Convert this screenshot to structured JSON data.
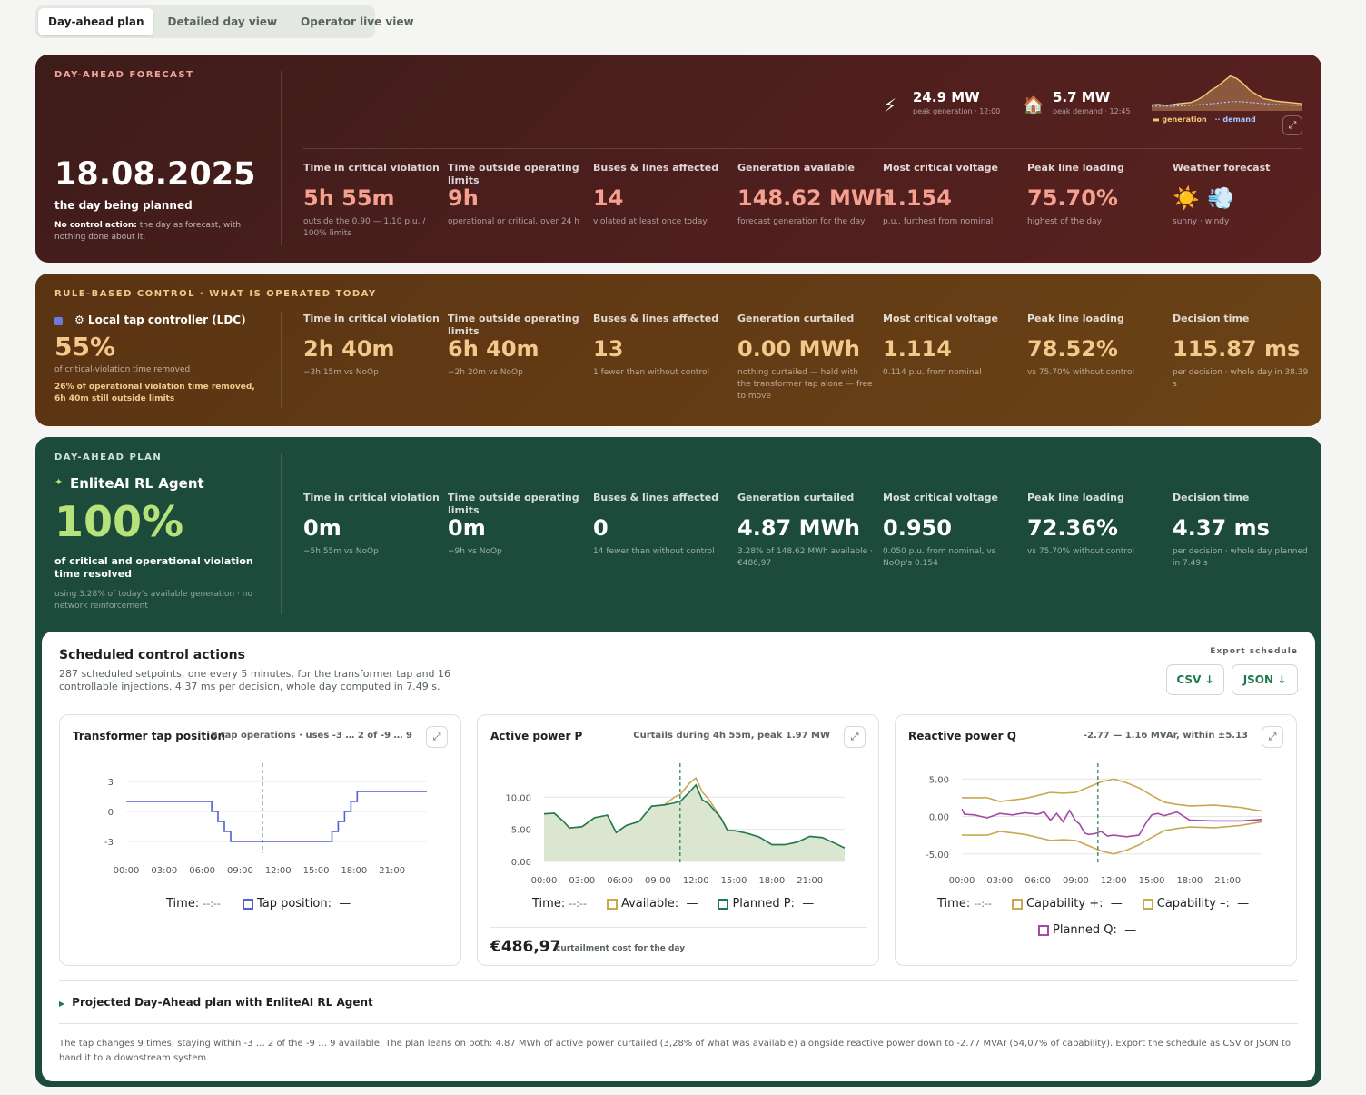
{
  "tabs": [
    "Day-ahead plan",
    "Detailed day view",
    "Operator live view"
  ],
  "forecast": {
    "eyebrow": "DAY-AHEAD FORECAST",
    "date": "18.08.2025",
    "date_caption": "the day being planned",
    "note_bold": "No control action:",
    "note_rest": " the day as forecast, with nothing done about it.",
    "peak_gen": {
      "value": "24.9 MW",
      "caption": "peak generation · 12:00"
    },
    "peak_demand": {
      "value": "5.7 MW",
      "caption": "peak demand · 12:45"
    },
    "spark_legend": {
      "generation": "generation",
      "demand": "demand"
    },
    "kpis": [
      {
        "label": "Time in critical violation",
        "value": "5h 55m",
        "sub": "outside the 0.90 — 1.10 p.u. / 100% limits"
      },
      {
        "label": "Time outside operating limits",
        "value": "9h",
        "sub": "operational or critical, over 24 h"
      },
      {
        "label": "Buses & lines affected",
        "value": "14",
        "sub": "violated at least once today"
      },
      {
        "label": "Generation available",
        "value": "148.62 MWh",
        "sub": "forecast generation for the day"
      },
      {
        "label": "Most critical voltage",
        "value": "1.154",
        "sub": "p.u., furthest from nominal"
      },
      {
        "label": "Peak line loading",
        "value": "75.70%",
        "sub": "highest of the day"
      },
      {
        "label": "Weather forecast",
        "value": "☀️ 💨",
        "sub": "sunny · windy"
      }
    ]
  },
  "rule": {
    "eyebrow": "RULE-BASED CONTROL · WHAT IS OPERATED TODAY",
    "name": "⚙ Local tap controller (LDC)",
    "pct": "55%",
    "pct_caption": "of critical-violation time removed",
    "note": "26% of operational violation time removed, 6h 40m still outside limits",
    "kpis": [
      {
        "label": "Time in critical violation",
        "value": "2h 40m",
        "sub": "−3h 15m vs NoOp"
      },
      {
        "label": "Time outside operating limits",
        "value": "6h 40m",
        "sub": "−2h 20m vs NoOp"
      },
      {
        "label": "Buses & lines affected",
        "value": "13",
        "sub": "1 fewer than without control"
      },
      {
        "label": "Generation curtailed",
        "value": "0.00 MWh",
        "sub": "nothing curtailed — held with the transformer tap alone — free to move"
      },
      {
        "label": "Most critical voltage",
        "value": "1.114",
        "sub": "0.114 p.u. from nominal"
      },
      {
        "label": "Peak line loading",
        "value": "78.52%",
        "sub": "vs 75.70% without control"
      },
      {
        "label": "Decision time",
        "value": "115.87 ms",
        "sub": "per decision · whole day in 38.39 s"
      }
    ]
  },
  "plan": {
    "eyebrow": "DAY-AHEAD PLAN",
    "name": "EnliteAI RL Agent",
    "pct": "100%",
    "pct_caption": "of critical and operational violation time resolved",
    "note": "using 3.28% of today's available generation · no network reinforcement",
    "kpis": [
      {
        "label": "Time in critical violation",
        "value": "0m",
        "sub": "−5h 55m vs NoOp"
      },
      {
        "label": "Time outside operating limits",
        "value": "0m",
        "sub": "−9h vs NoOp"
      },
      {
        "label": "Buses & lines affected",
        "value": "0",
        "sub": "14 fewer than without control"
      },
      {
        "label": "Generation curtailed",
        "value": "4.87 MWh",
        "sub": "3.28% of 148.62 MWh available · €486,97"
      },
      {
        "label": "Most critical voltage",
        "value": "0.950",
        "sub": "0.050 p.u. from nominal, vs NoOp's 0.154"
      },
      {
        "label": "Peak line loading",
        "value": "72.36%",
        "sub": "vs 75.70% without control"
      },
      {
        "label": "Decision time",
        "value": "4.37 ms",
        "sub": "per decision · whole day planned in 7.49 s"
      }
    ]
  },
  "schedule": {
    "title": "Scheduled control actions",
    "desc": "287 scheduled setpoints, one every 5 minutes, for the transformer tap and 16 controllable injections. 4.37 ms per decision, whole day computed in 7.49 s.",
    "export_label": "Export schedule",
    "csv": "CSV ↓",
    "json": "JSON ↓",
    "cost_value": "€486,97",
    "cost_caption": "curtailment cost for the day",
    "projected": "Projected Day-Ahead plan with EnliteAI RL Agent",
    "footer": "The tap changes 9 times, staying within -3 … 2 of the -9 … 9 available. The plan leans on both: 4.87 MWh of active power curtailed (3,28% of what was available) alongside reactive power down to -2.77 MVAr (54,07% of capability). Export the schedule as CSV or JSON to hand it to a downstream system."
  },
  "charts_text": {
    "tap": {
      "title": "Transformer tap position",
      "note": "9 tap operations · uses -3 … 2 of -9 … 9",
      "legend_time": "Time:",
      "legend_time_val": "--:--",
      "legend_series": "Tap position:",
      "legend_val": "—"
    },
    "p": {
      "title": "Active power P",
      "note": "Curtails during 4h 55m, peak 1.97 MW",
      "legend_time": "Time:",
      "legend_time_val": "--:--",
      "legend_avail": "Available:",
      "legend_planned": "Planned P:",
      "legend_val": "—"
    },
    "q": {
      "title": "Reactive power Q",
      "note": "-2.77 — 1.16 MVAr, within ±5.13",
      "legend_time": "Time:",
      "legend_time_val": "--:--",
      "legend_cap_p": "Capability +:",
      "legend_cap_m": "Capability –:",
      "legend_planned": "Planned Q:",
      "legend_val": "—"
    }
  },
  "chart_data": [
    {
      "type": "line",
      "id": "tap",
      "x": [
        "00:00",
        "03:00",
        "06:00",
        "09:00",
        "12:00",
        "15:00",
        "18:00",
        "21:00"
      ],
      "yticks": [
        "3",
        "0",
        "-3"
      ],
      "ylim": [
        -4,
        4
      ],
      "now": "10:45",
      "series": [
        {
          "name": "Tap position",
          "x": [
            0,
            6.75,
            6.75,
            7.25,
            7.25,
            7.75,
            7.75,
            8.25,
            8.25,
            16.25,
            16.25,
            16.75,
            16.75,
            17.25,
            17.25,
            17.75,
            17.75,
            18.25,
            18.25,
            23.75
          ],
          "y": [
            1,
            1,
            0,
            0,
            -1,
            -1,
            -2,
            -2,
            -3,
            -3,
            -2,
            -2,
            -1,
            -1,
            0,
            0,
            1,
            1,
            2,
            2
          ]
        }
      ]
    },
    {
      "type": "area",
      "id": "p",
      "x": [
        "00:00",
        "03:00",
        "06:00",
        "09:00",
        "12:00",
        "15:00",
        "18:00",
        "21:00"
      ],
      "yticks": [
        "10.00",
        "5.00",
        "0.00"
      ],
      "ylim": [
        0,
        14
      ],
      "now": "10:45",
      "series": [
        {
          "name": "Available",
          "x": [
            0,
            0.8,
            1.5,
            2,
            3,
            4,
            5,
            5.7,
            6.5,
            7.5,
            8.5,
            9.5,
            10.3,
            10.8,
            11.5,
            12,
            12.5,
            13,
            14,
            14.5,
            15,
            16,
            17,
            18,
            19,
            20,
            21,
            22,
            23,
            23.75
          ],
          "y": [
            7.4,
            7.5,
            6.3,
            5.2,
            5.4,
            6.8,
            7.2,
            4.5,
            5.6,
            6.2,
            8.6,
            8.8,
            10,
            10.5,
            12.2,
            13,
            10.8,
            9.7,
            6.7,
            4.8,
            4.8,
            4.4,
            3.8,
            2.6,
            2.6,
            3.0,
            3.9,
            3.7,
            2.8,
            2.1
          ]
        },
        {
          "name": "Planned P",
          "x": [
            0,
            0.8,
            1.5,
            2,
            3,
            4,
            5,
            5.7,
            6.5,
            7.5,
            8.5,
            9.5,
            10.3,
            10.8,
            11.5,
            12,
            12.5,
            13,
            14,
            14.5,
            15,
            16,
            17,
            18,
            19,
            20,
            21,
            22,
            23,
            23.75
          ],
          "y": [
            7.4,
            7.5,
            6.3,
            5.2,
            5.4,
            6.8,
            7.2,
            4.5,
            5.6,
            6.2,
            8.6,
            8.8,
            9.1,
            9.4,
            10.8,
            11.9,
            9.6,
            9.0,
            6.7,
            4.8,
            4.8,
            4.4,
            3.8,
            2.6,
            2.6,
            3.0,
            3.9,
            3.7,
            2.8,
            2.1
          ]
        }
      ]
    },
    {
      "type": "line",
      "id": "q",
      "x": [
        "00:00",
        "03:00",
        "06:00",
        "09:00",
        "12:00",
        "15:00",
        "18:00",
        "21:00"
      ],
      "yticks": [
        "5.00",
        "0.00",
        "-5.00"
      ],
      "ylim": [
        -6,
        6
      ],
      "now": "10:45",
      "series": [
        {
          "name": "Capability +",
          "x": [
            0,
            2,
            3,
            5,
            7,
            8,
            9,
            10,
            11,
            12,
            13,
            14,
            15,
            16,
            17,
            18,
            20,
            22,
            23.75
          ],
          "y": [
            2.5,
            2.5,
            2,
            2.4,
            3.2,
            3.1,
            3.2,
            3.9,
            4.6,
            5.0,
            4.5,
            3.8,
            2.8,
            1.9,
            1.6,
            1.4,
            1.5,
            1.2,
            0.7
          ]
        },
        {
          "name": "Capability –",
          "x": [
            0,
            2,
            3,
            5,
            7,
            8,
            9,
            10,
            11,
            12,
            13,
            14,
            15,
            16,
            17,
            18,
            20,
            22,
            23.75
          ],
          "y": [
            -2.5,
            -2.5,
            -2,
            -2.4,
            -3.2,
            -3.1,
            -3.2,
            -3.9,
            -4.6,
            -5.0,
            -4.5,
            -3.8,
            -2.8,
            -1.9,
            -1.6,
            -1.4,
            -1.5,
            -1.2,
            -0.7
          ]
        },
        {
          "name": "Planned Q",
          "x": [
            0,
            0.2,
            1,
            2,
            3,
            4,
            5,
            6,
            6.5,
            7,
            7.5,
            8,
            8.5,
            9,
            9.3,
            9.7,
            10,
            10.5,
            11,
            11.5,
            12,
            13,
            14,
            14.5,
            15,
            15.5,
            16,
            17,
            18,
            20,
            22,
            23.75
          ],
          "y": [
            1,
            0.3,
            0.2,
            -0.2,
            0.4,
            0.2,
            0.5,
            0.3,
            0.6,
            -0.5,
            0.4,
            -0.7,
            0.8,
            -0.6,
            -1.0,
            -2.2,
            -2.4,
            -2.3,
            -2.0,
            -2.6,
            -2.5,
            -2.7,
            -2.5,
            -1.0,
            0.2,
            0.4,
            0.1,
            0.6,
            -0.5,
            -0.6,
            -0.6,
            -0.4
          ]
        }
      ]
    },
    {
      "type": "area",
      "id": "spark",
      "x": [
        0,
        1,
        2,
        3,
        4,
        5,
        6,
        7,
        8,
        9,
        10,
        11,
        12,
        13,
        14,
        15,
        16,
        17,
        18,
        19,
        20,
        21,
        22,
        23
      ],
      "series": [
        {
          "name": "generation",
          "x": [
            0,
            1,
            2,
            3,
            4,
            5,
            6,
            7,
            8,
            9,
            10,
            11,
            12,
            13,
            14,
            15,
            16,
            17,
            18,
            19,
            20,
            21,
            22,
            23
          ],
          "y": [
            3,
            3.5,
            2.8,
            3.2,
            4,
            4.5,
            5,
            7,
            10,
            14,
            17,
            21,
            24.9,
            23,
            19,
            14,
            11,
            8,
            7,
            6,
            5.5,
            5,
            4.5,
            4
          ]
        },
        {
          "name": "demand",
          "x": [
            0,
            1,
            2,
            3,
            4,
            5,
            6,
            7,
            8,
            9,
            10,
            11,
            12,
            13,
            14,
            15,
            16,
            17,
            18,
            19,
            20,
            21,
            22,
            23
          ],
          "y": [
            2,
            2.1,
            2.2,
            2.1,
            2.3,
            2.5,
            2.8,
            3.2,
            3.6,
            4,
            4.4,
            5,
            5.5,
            5.7,
            5.4,
            5,
            4.6,
            4.2,
            3.8,
            3.5,
            3.2,
            3,
            2.8,
            2.6
          ]
        }
      ]
    }
  ]
}
